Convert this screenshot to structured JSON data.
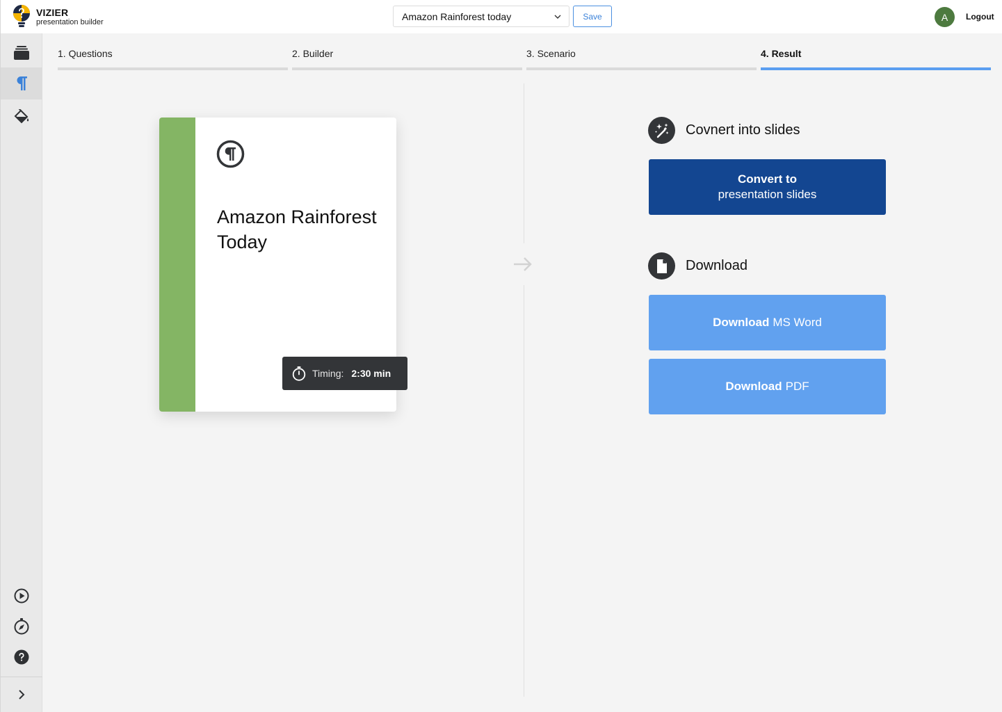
{
  "app": {
    "title": "VIZIER",
    "subtitle": "presentation builder"
  },
  "header": {
    "document_select": "Amazon Rainforest today",
    "save_label": "Save",
    "avatar_initial": "A",
    "logout_label": "Logout"
  },
  "sidebar": {
    "top_items": [
      {
        "icon": "layers-icon",
        "active": false
      },
      {
        "icon": "paragraph-icon",
        "active": true
      },
      {
        "icon": "paint-bucket-icon",
        "active": false
      }
    ],
    "bottom_items": [
      {
        "icon": "play-icon"
      },
      {
        "icon": "compass-icon"
      },
      {
        "icon": "help-icon"
      }
    ],
    "expand_icon": "chevron-right-icon"
  },
  "steps": [
    {
      "label": "1. Questions",
      "active": false
    },
    {
      "label": "2. Builder",
      "active": false
    },
    {
      "label": "3. Scenario",
      "active": false
    },
    {
      "label": "4. Result",
      "active": true
    }
  ],
  "preview": {
    "title": "Amazon Rainforest Today",
    "stripe_color": "#84b564",
    "timing_label": "Timing:",
    "timing_value": "2:30 min"
  },
  "convert_section": {
    "title": "Covnert into slides",
    "button_line1": "Convert to",
    "button_line2": "presentation slides"
  },
  "download_section": {
    "title": "Download",
    "word_bold": "Download",
    "word_rest": "MS Word",
    "pdf_bold": "Download",
    "pdf_rest": "PDF"
  },
  "colors": {
    "accent": "#5b9ef0",
    "primary_button": "#134691",
    "secondary_button": "#61a1ef"
  }
}
